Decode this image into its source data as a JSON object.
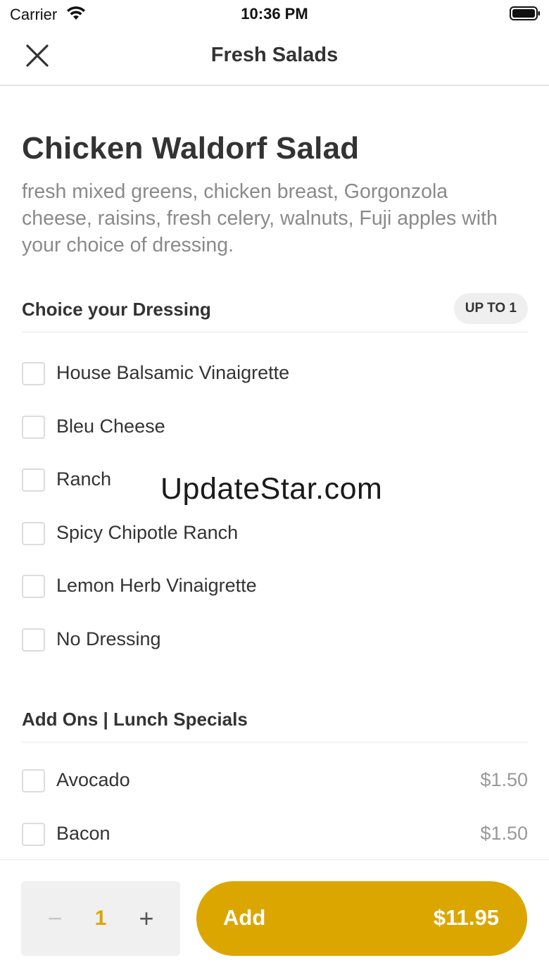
{
  "status_bar": {
    "carrier": "Carrier",
    "time": "10:36 PM"
  },
  "nav": {
    "title": "Fresh Salads",
    "close_icon": "close-icon"
  },
  "item": {
    "title": "Chicken Waldorf Salad",
    "description": "fresh mixed greens, chicken breast, Gorgonzola cheese, raisins, fresh celery, walnuts, Fuji apples with  your choice of dressing."
  },
  "dressing_section": {
    "title": "Choice your Dressing",
    "badge": "UP TO 1",
    "options": [
      {
        "label": "House Balsamic Vinaigrette"
      },
      {
        "label": "Bleu Cheese"
      },
      {
        "label": "Ranch"
      },
      {
        "label": "Spicy Chipotle Ranch"
      },
      {
        "label": "Lemon Herb Vinaigrette"
      },
      {
        "label": "No Dressing"
      }
    ]
  },
  "addons_section": {
    "title": "Add Ons | Lunch Specials",
    "options": [
      {
        "label": "Avocado",
        "price": "$1.50"
      },
      {
        "label": "Bacon",
        "price": "$1.50"
      }
    ]
  },
  "watermark": "UpdateStar.com",
  "footer": {
    "minus": "−",
    "quantity": "1",
    "plus": "+",
    "add_label": "Add",
    "add_price": "$11.95"
  },
  "colors": {
    "accent": "#dca600",
    "text": "#333333",
    "muted": "#8a8a8a"
  }
}
